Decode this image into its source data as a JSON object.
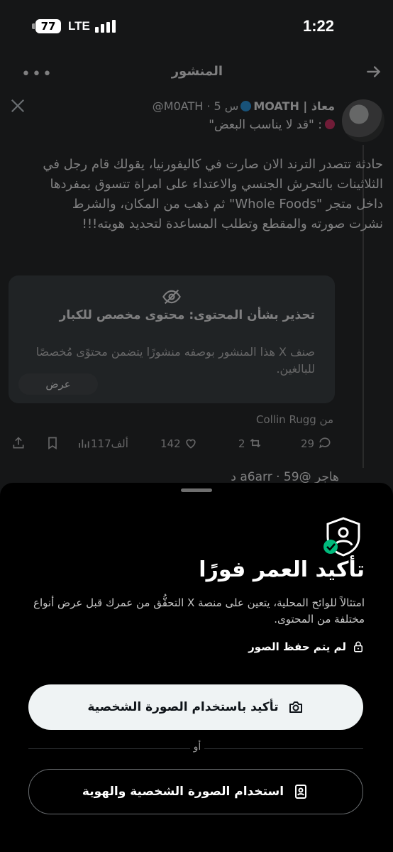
{
  "status": {
    "battery": "77",
    "network": "LTE",
    "time": "1:22"
  },
  "header": {
    "title": "المنشور"
  },
  "post": {
    "author_name": "معاذ | MOATH",
    "handle_time": "@M0ATH · 5 س",
    "quote": ": \"قد لا يناسب البعض\"",
    "body": "حادثة تتصدر الترند الان صارت في كاليفورنيا، يقولك قام رجل في الثلاثينات بالتحرش الجنسي والاعتداء على امراة تتسوق بمفردها داخل متجر \"Whole Foods\" ثم ذهب من المكان، والشرط نشرت صورته والمقطع وتطلب المساعدة لتحديد هويته!!!",
    "warning": {
      "title": "تحذير بشأن المحتوى: محتوى مخصص للكبار",
      "description": "صنف X هذا المنشور بوصفه منشورًا يتضمن محتوًى مُخصصًا للبالغين.",
      "show_label": "عرض"
    },
    "from": "من Collin Rugg",
    "stats": {
      "replies": "29",
      "reposts": "2",
      "likes": "142",
      "views": "117ألف"
    },
    "next_peek": "هاجر @a6arr · 59 د"
  },
  "sheet": {
    "title": "تأكيد العمر فورًا",
    "description": "امتثالاً للوائح المحلية، يتعين على منصة X التحقُّق من عمرك قبل عرض أنواع مختلفة من المحتوى.",
    "privacy_note": "لم يتم حفظ الصور",
    "primary_button": "تأكيد باستخدام الصورة الشخصية",
    "or_label": "أو",
    "secondary_button": "استخدام الصورة الشخصية والهوية"
  },
  "colors": {
    "accent_verified": "#1d9bf0",
    "success_check": "#00ba7c",
    "sheet_bg": "#000000",
    "button_light": "#eff3f4"
  }
}
